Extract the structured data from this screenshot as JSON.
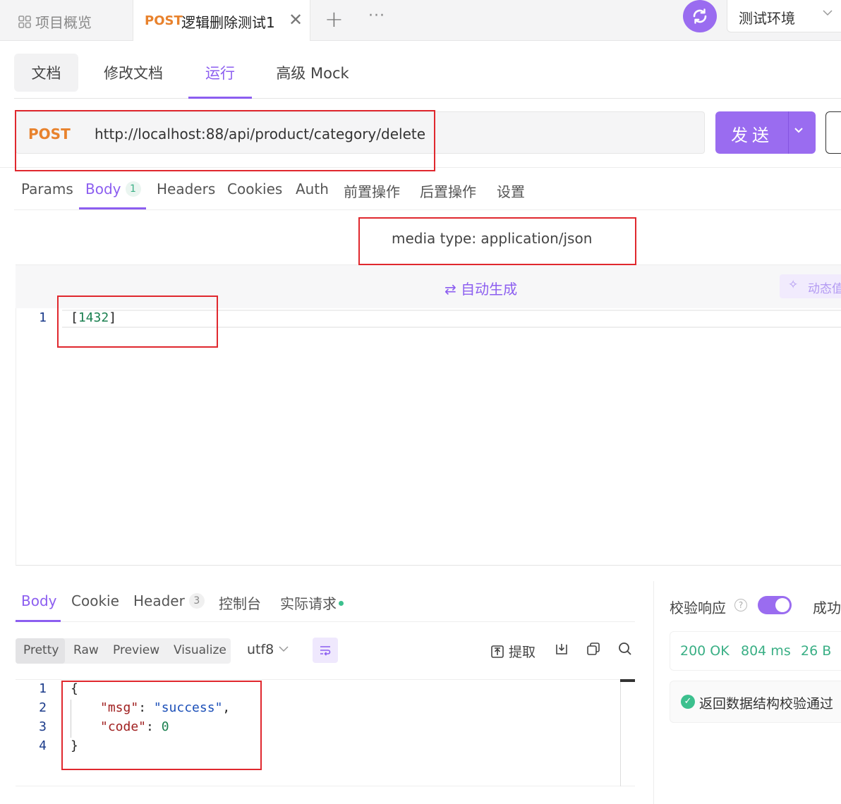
{
  "top_tabs": {
    "overview_label": "项目概览",
    "active_method": "POST",
    "active_name": "逻辑删除测试1",
    "close_glyph": "✕",
    "plus_glyph": "+",
    "more_glyph": "···"
  },
  "environment": {
    "label": "测试环境"
  },
  "doc_tabs": [
    {
      "label": "文档"
    },
    {
      "label": "修改文档"
    },
    {
      "label": "运行"
    },
    {
      "label": "高级 Mock"
    }
  ],
  "request": {
    "method": "POST",
    "url": "http://localhost:88/api/product/category/delete",
    "send_label": "发送"
  },
  "request_tabs": [
    {
      "label": "Params"
    },
    {
      "label": "Body",
      "badge": "1"
    },
    {
      "label": "Headers"
    },
    {
      "label": "Cookies"
    },
    {
      "label": "Auth"
    },
    {
      "label": "前置操作"
    },
    {
      "label": "后置操作"
    },
    {
      "label": "设置"
    }
  ],
  "body": {
    "media_type": "media type: application/json",
    "autogen_label": "自动生成",
    "dynamic_label": "动态值",
    "code_lines": [
      {
        "ln": "1",
        "open": "[",
        "value": "1432",
        "close": "]"
      }
    ]
  },
  "response_tabs": [
    {
      "label": "Body"
    },
    {
      "label": "Cookie"
    },
    {
      "label": "Header",
      "badge": "3"
    },
    {
      "label": "控制台"
    },
    {
      "label": "实际请求"
    }
  ],
  "response_toolbar": {
    "views": [
      "Pretty",
      "Raw",
      "Preview",
      "Visualize"
    ],
    "encoding": "utf8",
    "extract_label": "提取"
  },
  "response_code": {
    "line_numbers": [
      "1",
      "2",
      "3",
      "4"
    ],
    "open_brace": "{",
    "msg_key": "\"msg\"",
    "msg_value": "\"success\"",
    "code_key": "\"code\"",
    "code_value": "0",
    "close_brace": "}"
  },
  "validation": {
    "label": "校验响应",
    "toggle_on": true,
    "success_label": "成功",
    "status": "200 OK",
    "time": "804 ms",
    "size": "26 B",
    "check_text": "返回数据结构校验通过"
  },
  "colors": {
    "accent": "#9a6cf0",
    "post_method": "#e8822d",
    "success_green": "#3aaf85",
    "annotation_red": "#e0282e"
  }
}
